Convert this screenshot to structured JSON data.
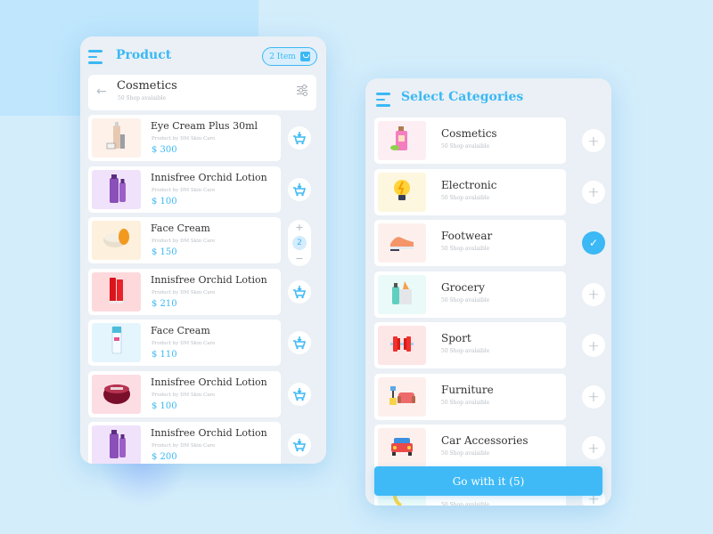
{
  "product_panel": {
    "title": "Product",
    "cart_badge": "2 Item",
    "search": {
      "title": "Cosmetics",
      "subtitle": "50 Shop avalaible"
    },
    "items": [
      {
        "name": "Eye Cream Plus 30ml",
        "by": "Product by DM Skin Care",
        "price": "$ 300",
        "thumb_bg": "#fdf1ea",
        "thumb_icon": "serum-bottle-icon",
        "action": "cart"
      },
      {
        "name": "Innisfree Orchid Lotion",
        "by": "Product by DM Skin Care",
        "price": "$ 100",
        "thumb_bg": "#f0e2fb",
        "thumb_icon": "lotion-bottle-icon",
        "action": "cart"
      },
      {
        "name": "Face Cream",
        "by": "Product by DM Skin Care",
        "price": "$ 150",
        "thumb_bg": "#fdf0dc",
        "thumb_icon": "cream-jar-icon",
        "action": "stepper",
        "quantity": "2"
      },
      {
        "name": "Innisfree Orchid Lotion",
        "by": "Product by DM Skin Care",
        "price": "$ 210",
        "thumb_bg": "#fdd9dc",
        "thumb_icon": "tube-icon",
        "action": "cart"
      },
      {
        "name": "Face Cream",
        "by": "Product by DM Skin Care",
        "price": "$ 110",
        "thumb_bg": "#e5f5fd",
        "thumb_icon": "tube-icon",
        "action": "cart"
      },
      {
        "name": "Innisfree Orchid Lotion",
        "by": "Product by DM Skin Care",
        "price": "$ 100",
        "thumb_bg": "#fddde4",
        "thumb_icon": "cream-jar-icon",
        "action": "cart"
      },
      {
        "name": "Innisfree Orchid Lotion",
        "by": "Product by DM Skin Care",
        "price": "$ 200",
        "thumb_bg": "#f0e2fb",
        "thumb_icon": "lotion-bottle-icon",
        "action": "cart"
      }
    ],
    "stepper": {
      "plus": "+",
      "minus": "−"
    }
  },
  "categories_panel": {
    "title": "Select Categories",
    "items": [
      {
        "name": "Cosmetics",
        "sub": "50 Shop avalaible",
        "thumb_bg": "#fdeef3",
        "icon": "cosmetics-icon",
        "glyph": "🧴",
        "selected": false
      },
      {
        "name": "Electronic",
        "sub": "50 Shop avalaible",
        "thumb_bg": "#fdf7df",
        "icon": "lightbulb-icon",
        "glyph": "💡",
        "selected": false
      },
      {
        "name": "Footwear",
        "sub": "50 Shop avalaible",
        "thumb_bg": "#fdf0ec",
        "icon": "sneaker-icon",
        "glyph": "👟",
        "selected": true
      },
      {
        "name": "Grocery",
        "sub": "50 Shop avalaible",
        "thumb_bg": "#eafaf8",
        "icon": "grocery-bag-icon",
        "glyph": "🛍",
        "selected": false
      },
      {
        "name": "Sport",
        "sub": "50 Shop avalaible",
        "thumb_bg": "#fde6e6",
        "icon": "dumbbell-icon",
        "glyph": "🏋",
        "selected": false
      },
      {
        "name": "Furniture",
        "sub": "50 Shop avalaible",
        "thumb_bg": "#fdf0ec",
        "icon": "sofa-icon",
        "glyph": "🛋",
        "selected": false
      },
      {
        "name": "Car Accessories",
        "sub": "50 Shop avalaible",
        "thumb_bg": "#fdf0ec",
        "icon": "car-icon",
        "glyph": "🚗",
        "selected": false
      },
      {
        "name": "",
        "sub": "50 Shop avalaible",
        "thumb_bg": "#eafaf8",
        "icon": "partial-category-icon",
        "glyph": "",
        "selected": false
      }
    ],
    "add_glyph": "+",
    "check_glyph": "✓",
    "go_button": "Go with it (5)"
  },
  "colors": {
    "accent": "#3bb8f5",
    "panel_bg": "#eaf0f5",
    "page_bg": "#d3edfb"
  }
}
